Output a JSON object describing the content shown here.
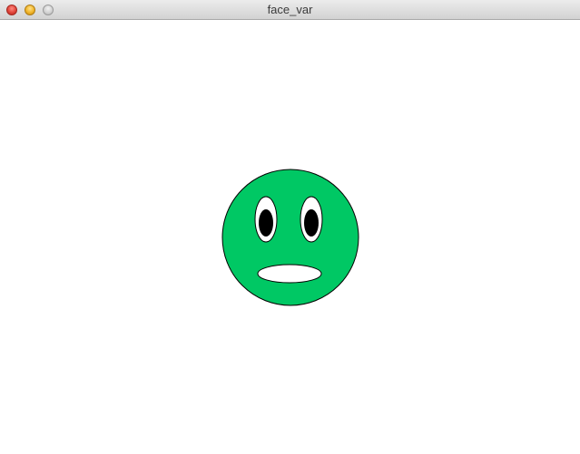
{
  "window": {
    "title": "face_var"
  },
  "colors": {
    "face_fill": "#00c864",
    "face_stroke": "#000000",
    "eye_white": "#ffffff",
    "pupil": "#000000",
    "mouth": "#ffffff",
    "background": "#ffffff"
  },
  "icons": {
    "close": "close-icon",
    "minimize": "minimize-icon",
    "zoom": "zoom-icon"
  }
}
